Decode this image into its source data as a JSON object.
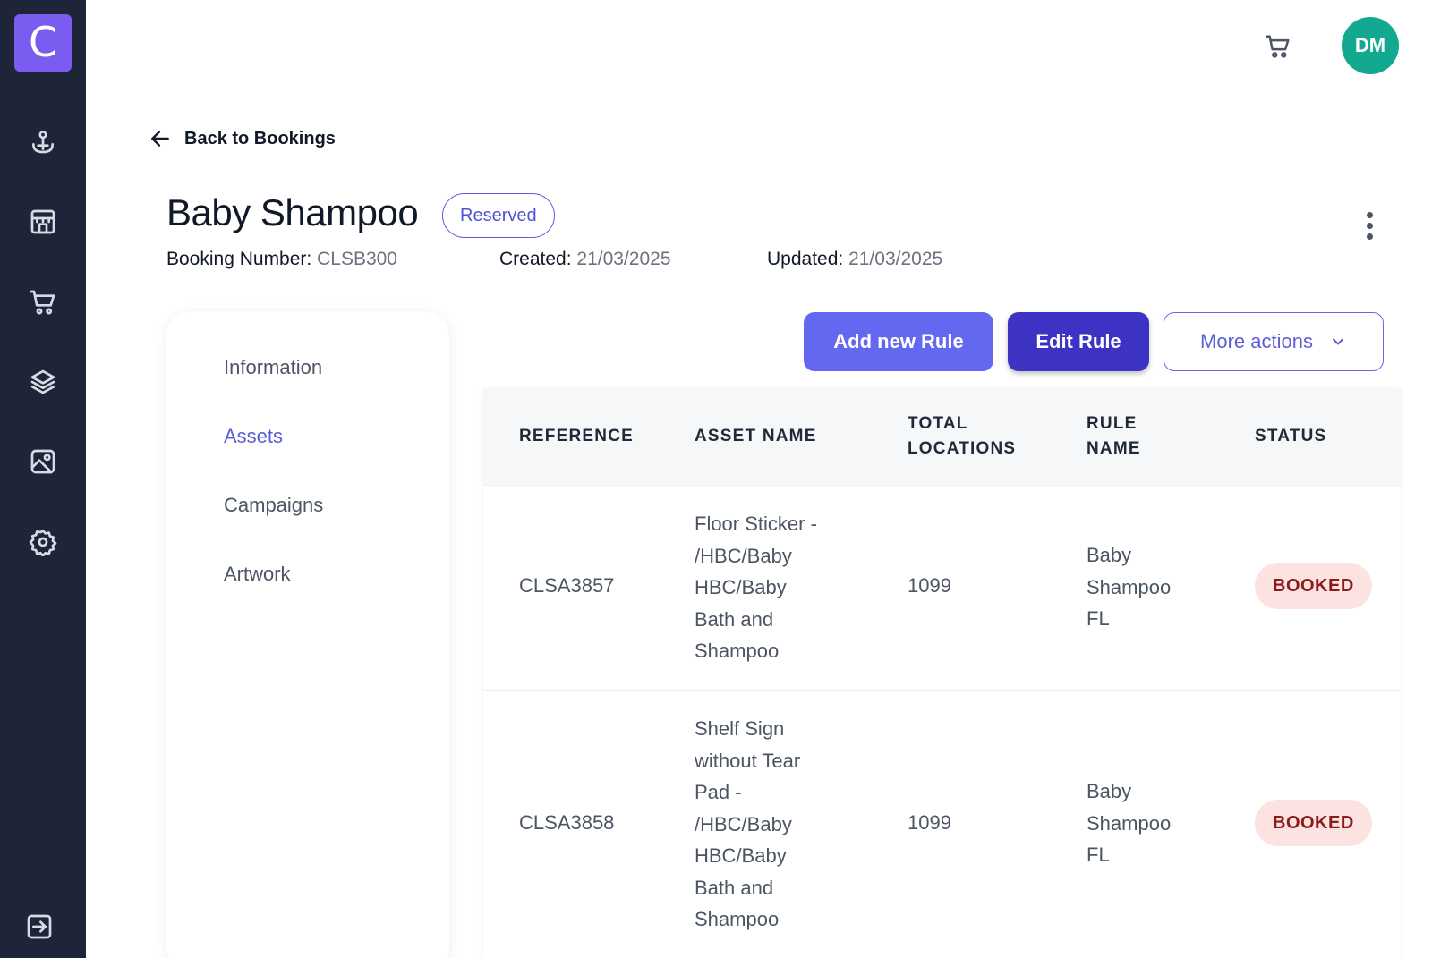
{
  "logo": {
    "letter": "C"
  },
  "sidebar": {
    "items": [
      {
        "icon": "anchor-icon"
      },
      {
        "icon": "store-icon"
      },
      {
        "icon": "cart-icon"
      },
      {
        "icon": "layers-icon"
      },
      {
        "icon": "image-icon"
      },
      {
        "icon": "gear-icon"
      }
    ],
    "logout_icon": "logout-icon"
  },
  "header": {
    "cart_icon": "cart-icon",
    "avatar_initials": "DM"
  },
  "back_link": {
    "label": "Back to Bookings"
  },
  "booking": {
    "title": "Baby Shampoo",
    "status": "Reserved",
    "booking_number_label": "Booking Number:",
    "booking_number": "CLSB300",
    "created_label": "Created:",
    "created": "21/03/2025",
    "updated_label": "Updated:",
    "updated": "21/03/2025"
  },
  "tabs": [
    {
      "label": "Information",
      "active": false
    },
    {
      "label": "Assets",
      "active": true
    },
    {
      "label": "Campaigns",
      "active": false
    },
    {
      "label": "Artwork",
      "active": false
    }
  ],
  "actions": {
    "add_rule": "Add new Rule",
    "edit_rule": "Edit Rule",
    "more_actions": "More actions"
  },
  "table": {
    "columns": {
      "reference": "REFERENCE",
      "asset_name": "ASSET NAME",
      "total_locations_1": "TOTAL",
      "total_locations_2": "LOCATIONS",
      "rule_name_1": "RULE",
      "rule_name_2": "NAME",
      "status": "STATUS"
    },
    "rows": [
      {
        "reference": "CLSA3857",
        "asset_name": [
          "Floor Sticker -",
          "/HBC/Baby",
          "HBC/Baby",
          "Bath and",
          "Shampoo"
        ],
        "total_locations": "1099",
        "rule_name": [
          "Baby",
          "Shampoo",
          "FL"
        ],
        "status": "BOOKED"
      },
      {
        "reference": "CLSA3858",
        "asset_name": [
          "Shelf Sign",
          "without Tear",
          "Pad -",
          "/HBC/Baby",
          "HBC/Baby",
          "Bath and",
          "Shampoo"
        ],
        "total_locations": "1099",
        "rule_name": [
          "Baby",
          "Shampoo",
          "FL"
        ],
        "status": "BOOKED"
      }
    ]
  },
  "colors": {
    "sidebar_bg": "#1e2538",
    "logo_bg": "#7b5cf0",
    "accent": "#6467f0",
    "accent_dark": "#3c32c4",
    "avatar_bg": "#13a990",
    "booked_bg": "#fde2e2",
    "booked_text": "#8a1c1c"
  }
}
